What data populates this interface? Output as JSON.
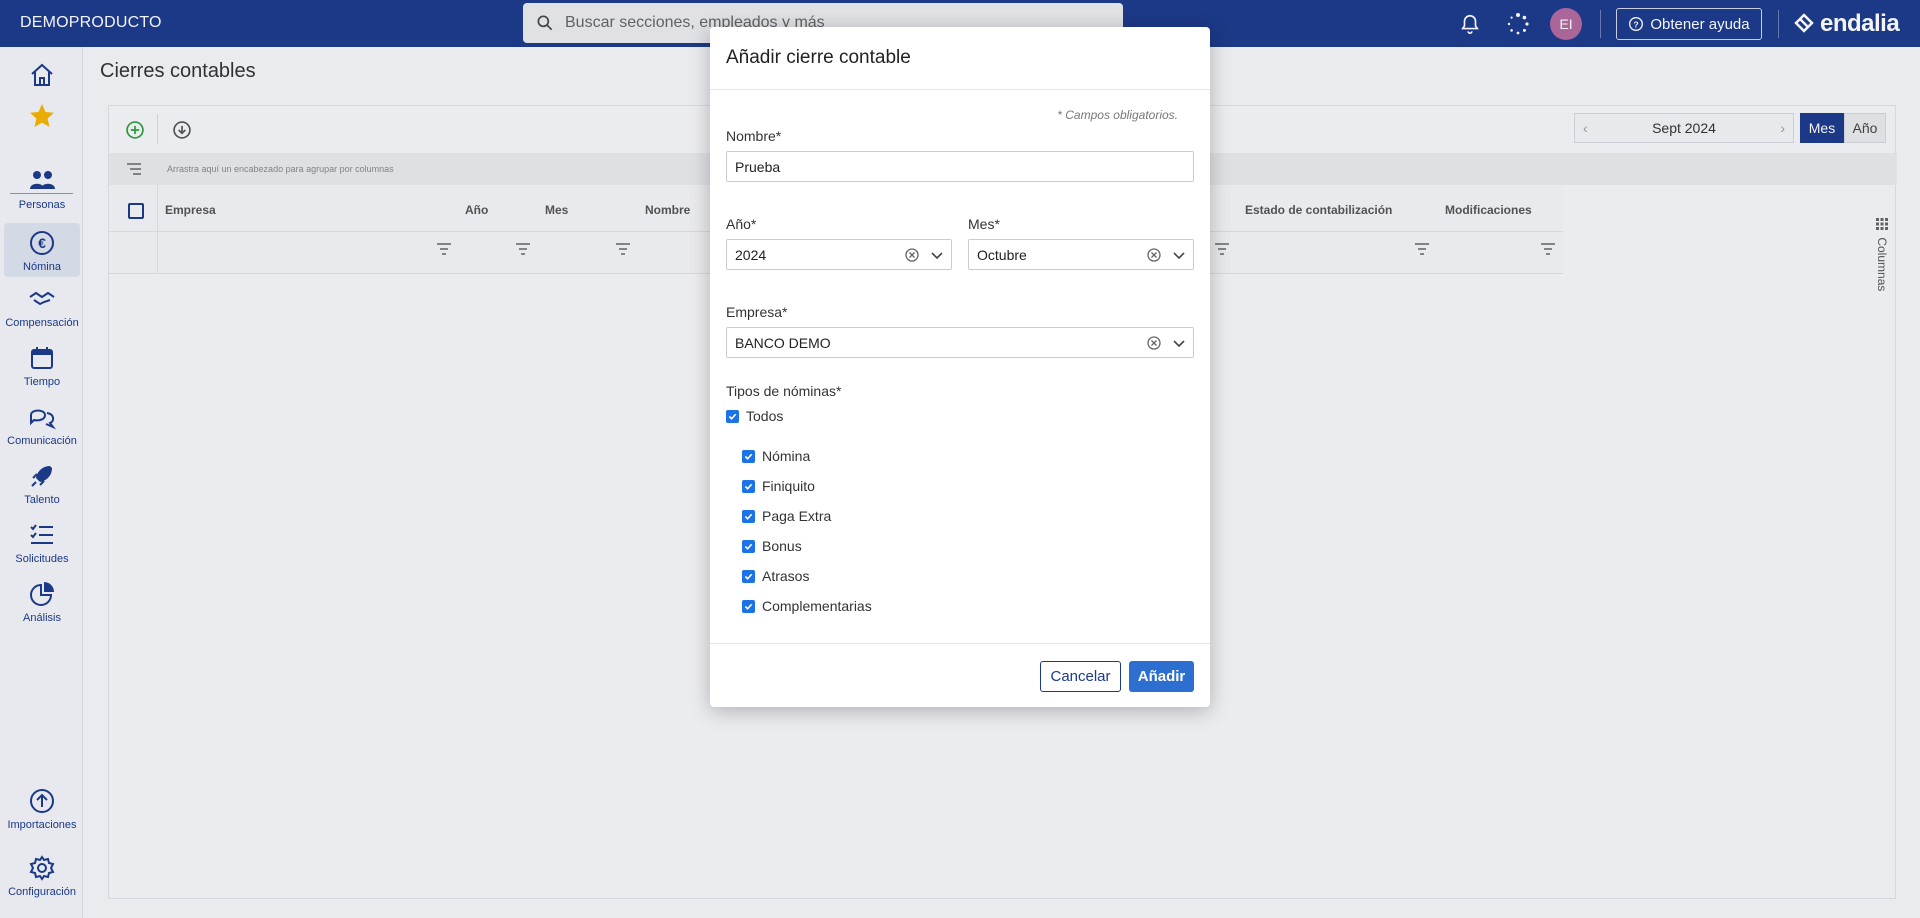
{
  "topbar": {
    "brand": "DEMOPRODUCTO",
    "search_placeholder": "Buscar secciones, empleados y más",
    "avatar_initials": "EI",
    "help_label": "Obtener ayuda",
    "logo": "endalia"
  },
  "sidebar": {
    "items": [
      {
        "label": "Personas"
      },
      {
        "label": "Nómina"
      },
      {
        "label": "Compensación"
      },
      {
        "label": "Tiempo"
      },
      {
        "label": "Comunicación"
      },
      {
        "label": "Talento"
      },
      {
        "label": "Solicitudes"
      },
      {
        "label": "Análisis"
      },
      {
        "label": "Importaciones"
      },
      {
        "label": "Configuración"
      }
    ]
  },
  "page": {
    "title": "Cierres contables",
    "group_hint": "Arrastra aquí un encabezado para agrupar por columnas",
    "columns": [
      "Empresa",
      "Año",
      "Mes",
      "Nombre",
      "Estado de contabilización",
      "Modificaciones"
    ],
    "period": "Sept 2024",
    "mode_month": "Mes",
    "mode_year": "Año",
    "columns_tab": "Columnas"
  },
  "modal": {
    "title": "Añadir cierre contable",
    "required_note": "* Campos obligatorios.",
    "name_label": "Nombre*",
    "name_value": "Prueba",
    "year_label": "Año*",
    "year_value": "2024",
    "month_label": "Mes*",
    "month_value": "Octubre",
    "company_label": "Empresa*",
    "company_value": "BANCO DEMO",
    "types_label": "Tipos de nóminas*",
    "all_label": "Todos",
    "types": [
      "Nómina",
      "Finiquito",
      "Paga Extra",
      "Bonus",
      "Atrasos",
      "Complementarias"
    ],
    "cancel_label": "Cancelar",
    "add_label": "Añadir"
  },
  "colors": {
    "brand": "#1c3a8c",
    "accent": "#2d6fd1",
    "checkbox": "#1a73e8"
  }
}
